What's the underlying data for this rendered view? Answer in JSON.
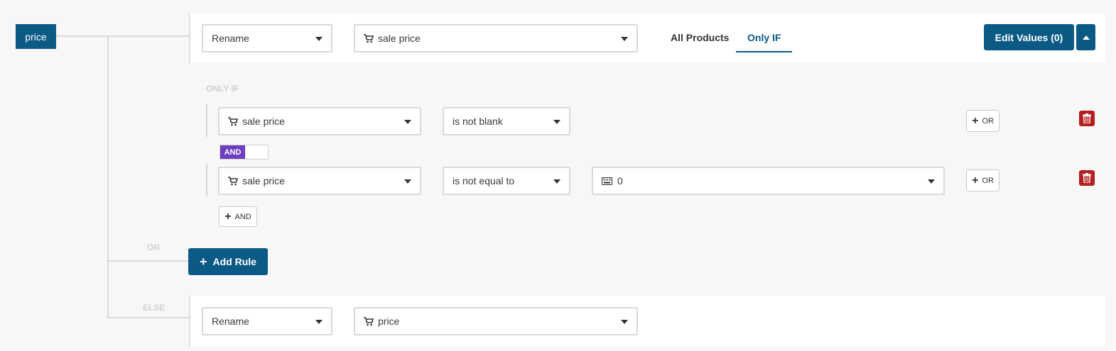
{
  "field": {
    "name": "price"
  },
  "rule": {
    "action": "Rename",
    "target": "sale price",
    "tabs": {
      "all_products": "All Products",
      "only_if": "Only IF"
    },
    "active_tab": "Only IF",
    "edit_values_label": "Edit Values (0)"
  },
  "only_if": {
    "heading": "ONLY IF",
    "conditions": [
      {
        "field": "sale price",
        "operator": "is not blank",
        "or_label": "OR"
      },
      {
        "field": "sale price",
        "operator": "is not equal to",
        "value": "0",
        "or_label": "OR"
      }
    ],
    "and_toggle_label": "AND",
    "add_and_label": "AND"
  },
  "or_label": "OR",
  "add_rule_label": "Add Rule",
  "else": {
    "label": "ELSE",
    "action": "Rename",
    "target": "price"
  },
  "colors": {
    "primary": "#0b5a85",
    "and_toggle": "#6b3fbf",
    "danger": "#b61f1f"
  }
}
